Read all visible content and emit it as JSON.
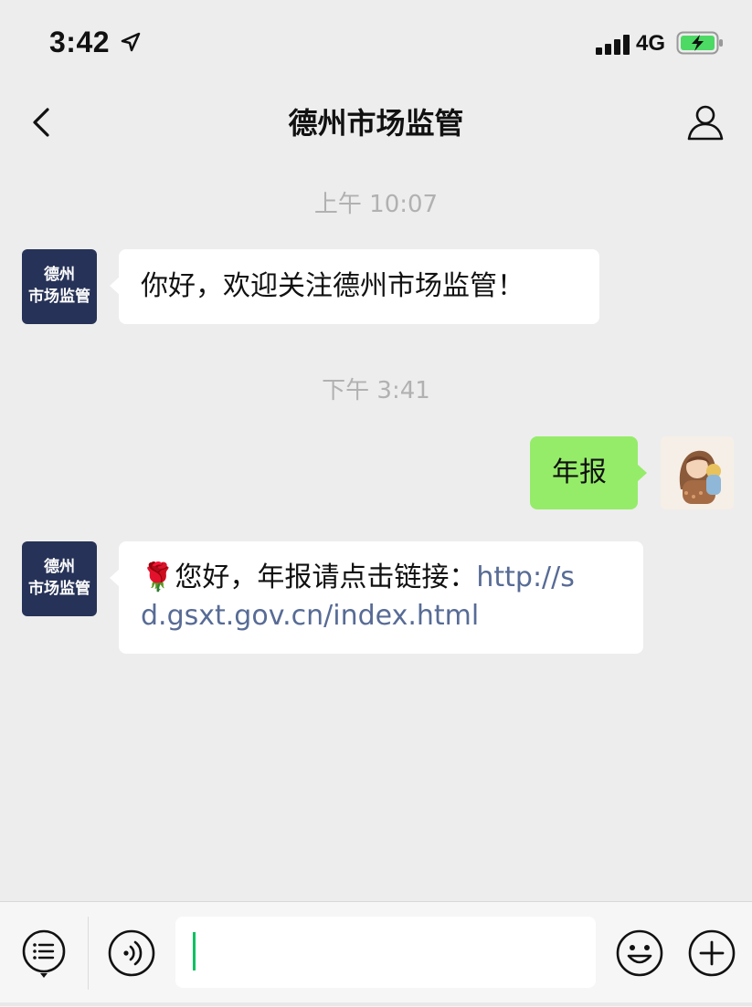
{
  "status_bar": {
    "time": "3:42",
    "network": "4G"
  },
  "nav": {
    "title": "德州市场监管"
  },
  "official_account": {
    "avatar_line1": "德州",
    "avatar_line2": "市场监管"
  },
  "messages": [
    {
      "timestamp": "上午 10:07",
      "sender": "德州市场监管",
      "text": "你好，欢迎关注德州市场监管！"
    },
    {
      "timestamp": "下午 3:41",
      "sender": "me",
      "text": "年报"
    },
    {
      "sender": "德州市场监管",
      "emoji": "🌹",
      "text_prefix": "您好，年报请点击链接：",
      "link_line1": "http://s",
      "link_line2": "d.gsxt.gov.cn/index.html"
    }
  ],
  "input_bar": {
    "value": ""
  },
  "colors": {
    "background": "#ededed",
    "outgoing_bubble": "#95ec69",
    "incoming_bubble": "#ffffff",
    "link": "#576b95",
    "account_avatar": "#263257",
    "battery_fill": "#4cd964",
    "caret": "#07c160"
  },
  "icons": {
    "back": "chevron-left-icon",
    "profile": "person-icon",
    "menu": "list-menu-icon",
    "voice": "voice-icon",
    "emoji": "smiley-icon",
    "more": "plus-icon",
    "location": "location-arrow-icon",
    "signal": "signal-icon",
    "battery": "battery-charging-icon"
  }
}
